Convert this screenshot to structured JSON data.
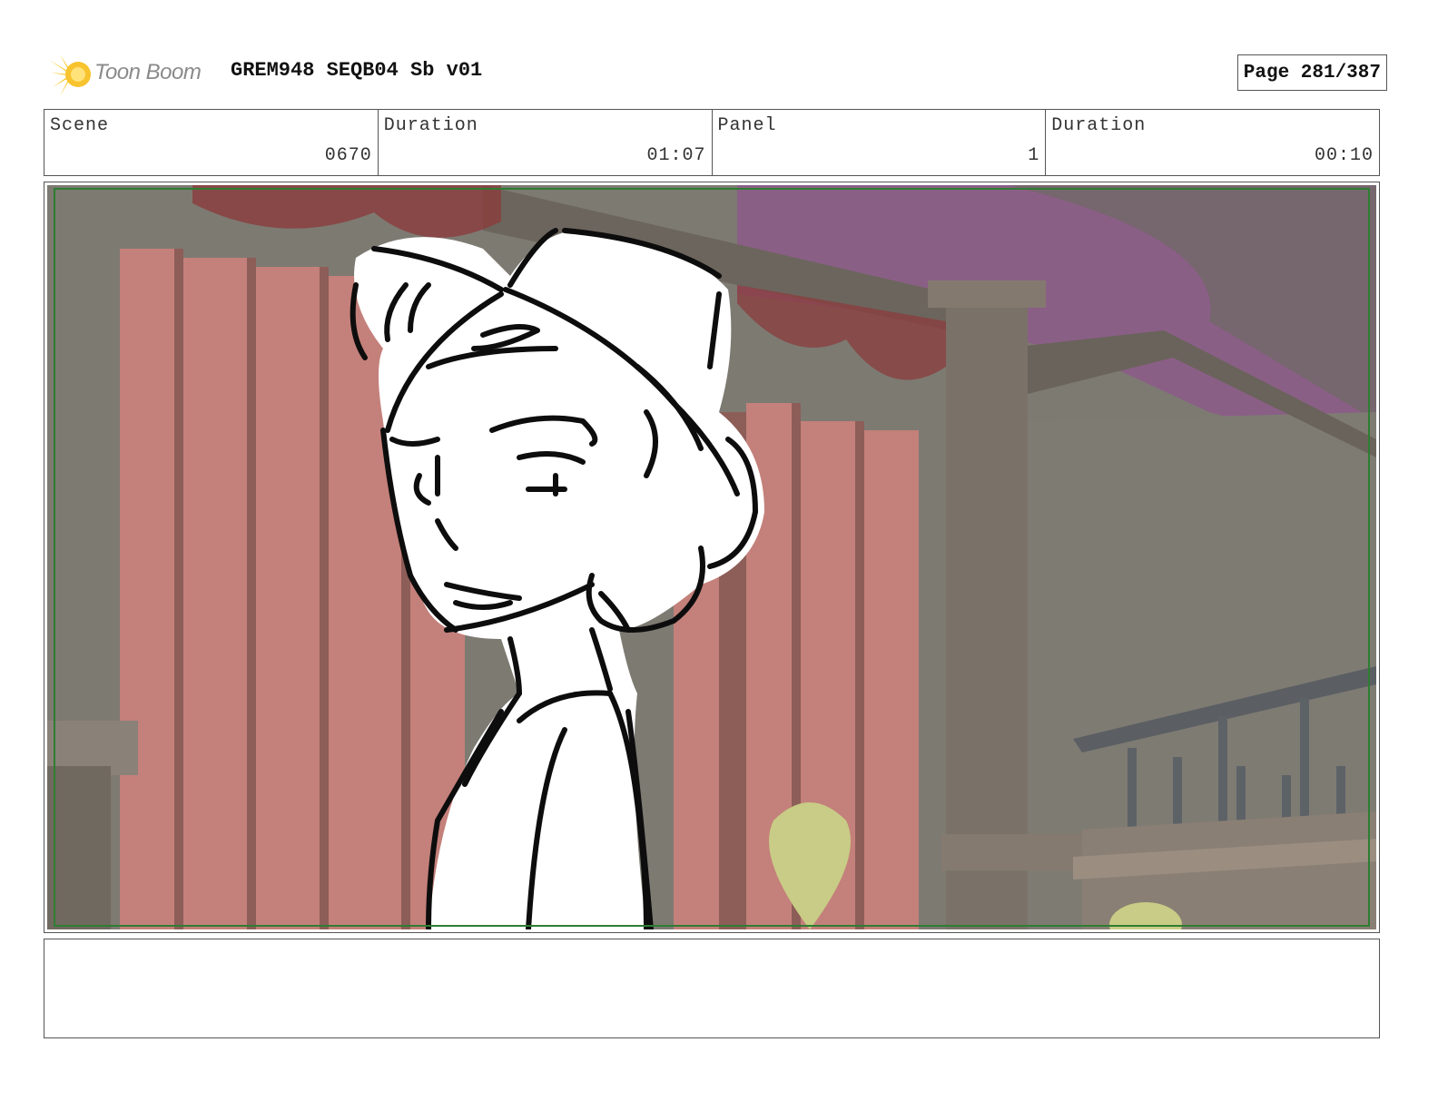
{
  "header": {
    "logo_text": "Toon Boom",
    "doc_title": "GREM948 SEQB04 Sb v01",
    "page_label": "Page 281/387"
  },
  "info": {
    "scene_label": "Scene",
    "scene_value": "0670",
    "scene_duration_label": "Duration",
    "scene_duration_value": "01:07",
    "panel_label": "Panel",
    "panel_value": "1",
    "panel_duration_label": "Duration",
    "panel_duration_value": "00:10"
  },
  "colors": {
    "safe_frame": "#2e7d32",
    "logo_yellow": "#f5c518",
    "curtain_red": "#c4807a",
    "ceiling_purple": "#8a5f86"
  },
  "notes": {
    "text": ""
  }
}
